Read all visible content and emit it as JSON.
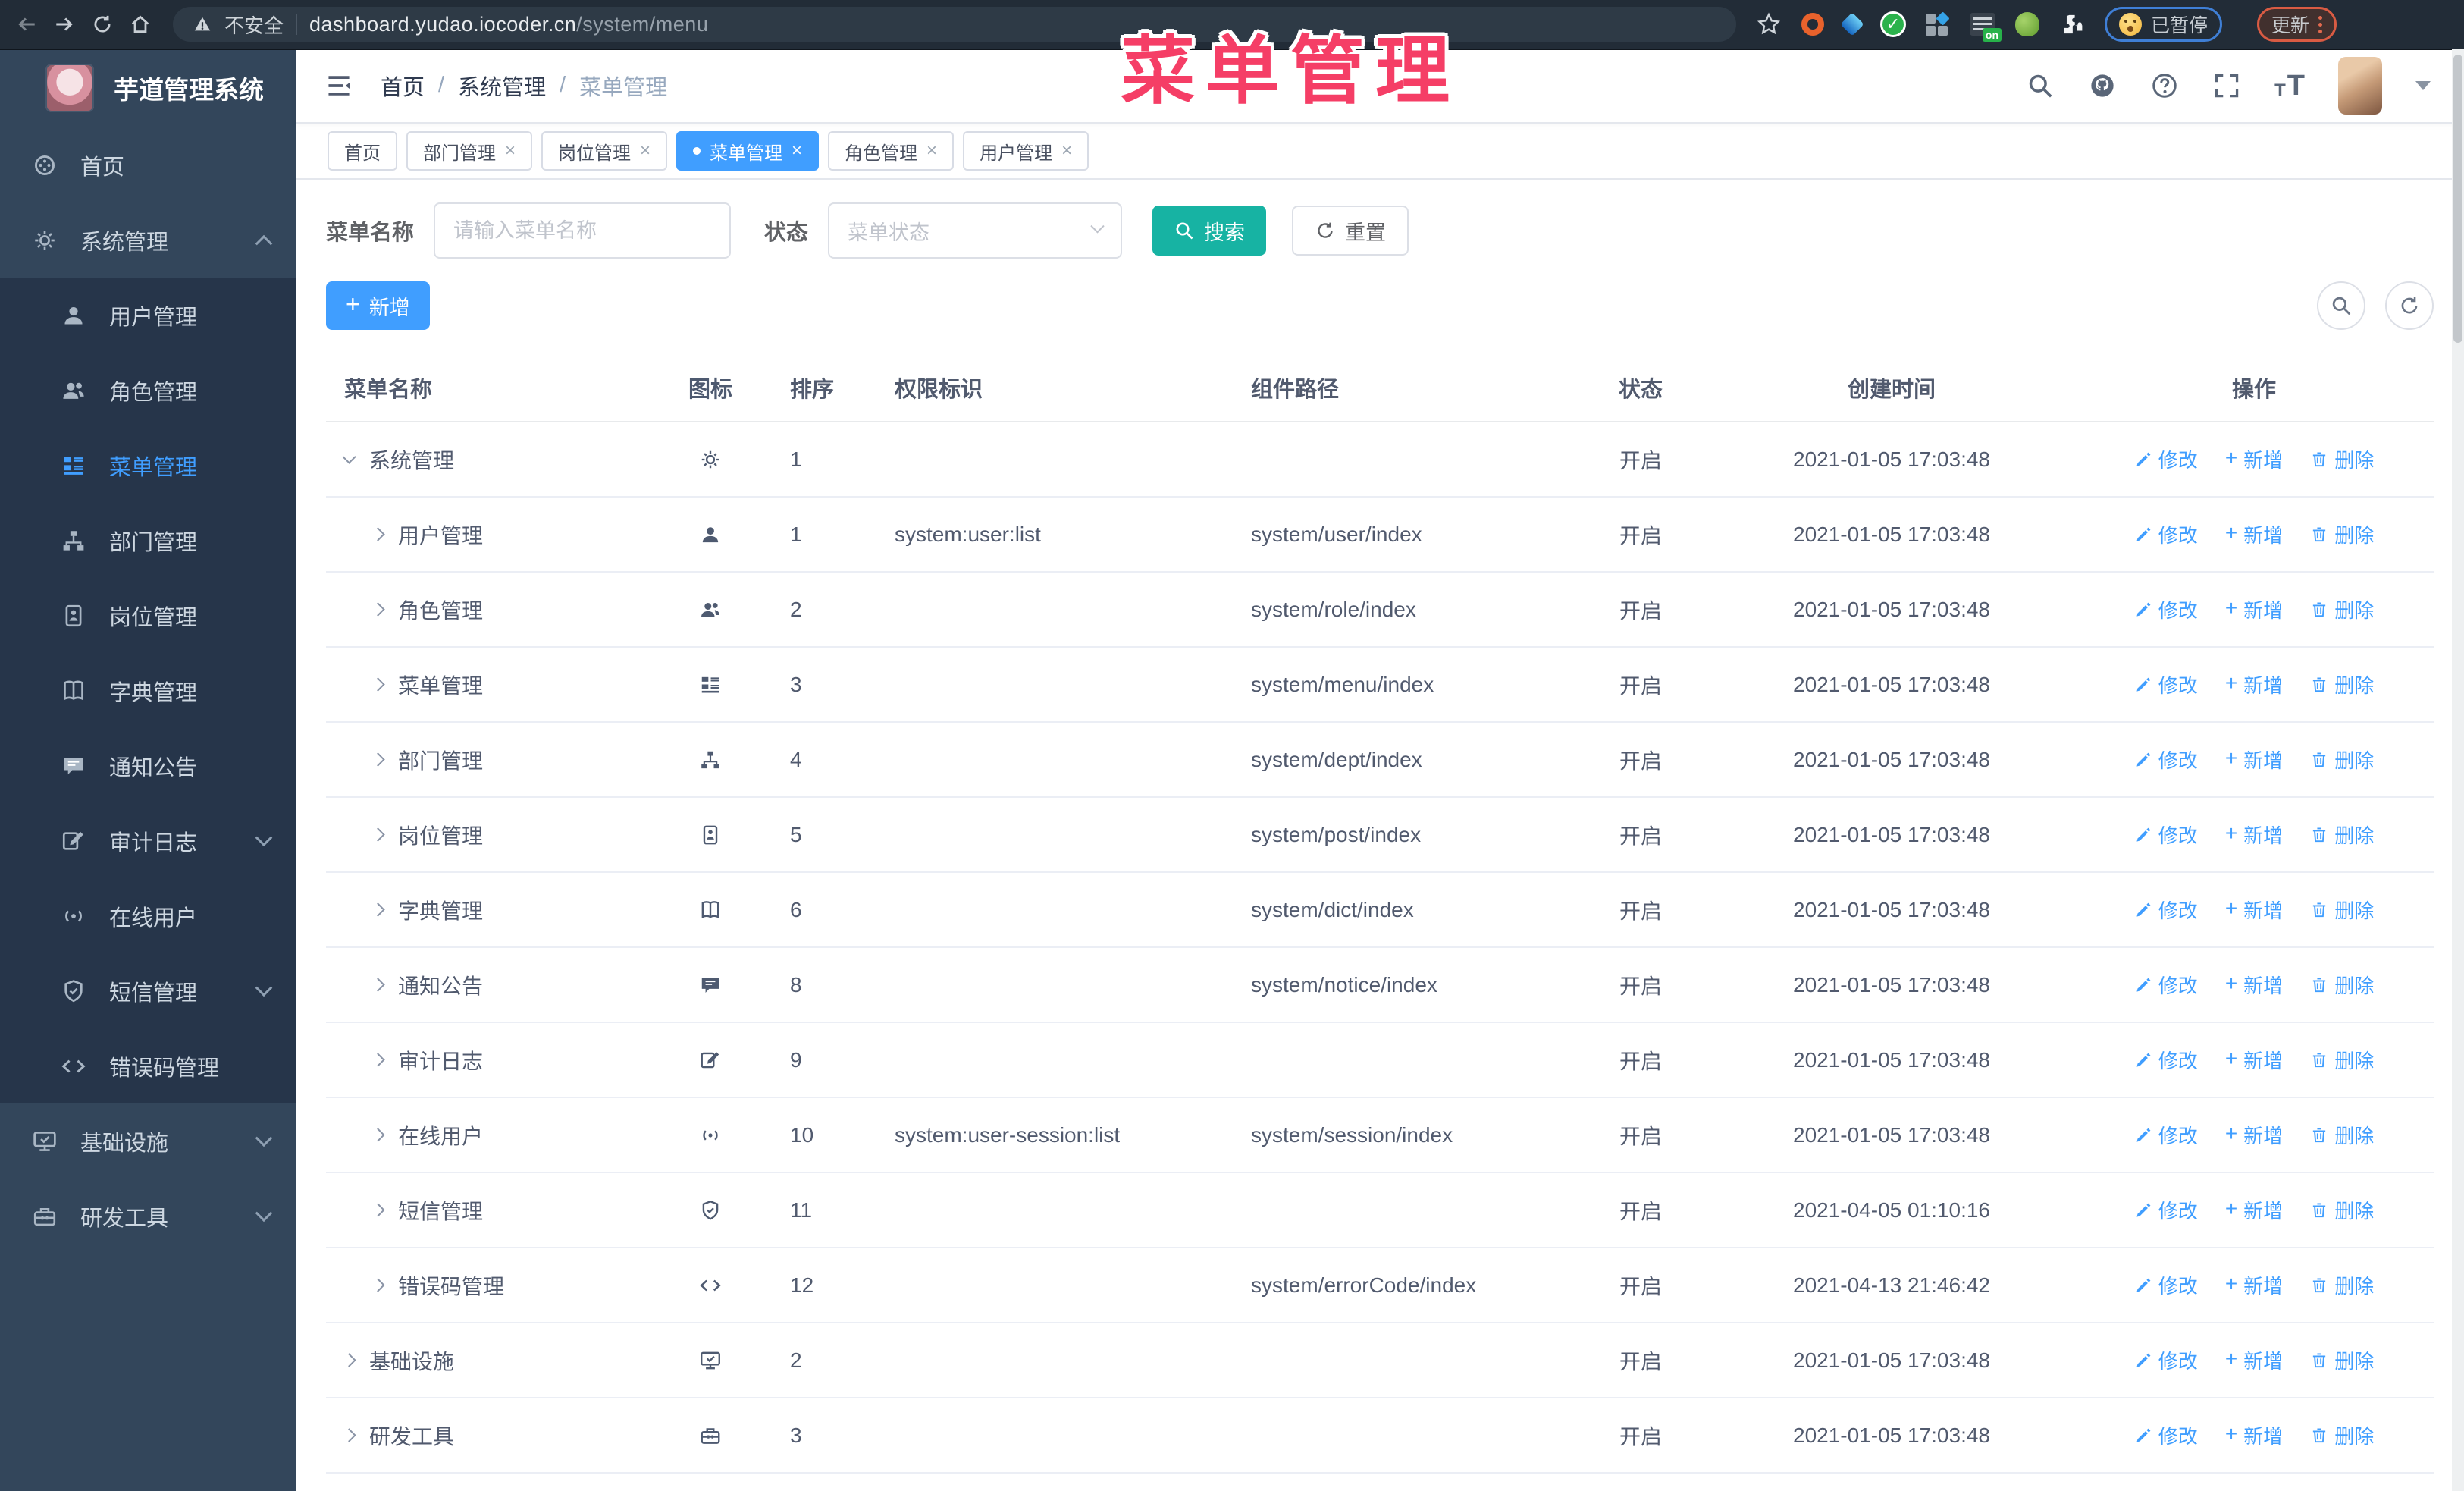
{
  "browser": {
    "security_label": "不安全",
    "url_host": "dashboard.yudao.iocoder.cn",
    "url_path": "/system/menu",
    "paused_label": "已暂停",
    "update_label": "更新"
  },
  "annotation": {
    "text": "菜单管理",
    "color": "#f53e66"
  },
  "sidebar": {
    "title": "芋道管理系统",
    "items": [
      {
        "id": "home",
        "label": "首页",
        "icon": "home"
      },
      {
        "id": "system",
        "label": "系统管理",
        "icon": "gear",
        "chevron": "up"
      },
      {
        "id": "user",
        "label": "用户管理",
        "icon": "user",
        "child": true
      },
      {
        "id": "role",
        "label": "角色管理",
        "icon": "users",
        "child": true
      },
      {
        "id": "menu",
        "label": "菜单管理",
        "icon": "menu",
        "child": true,
        "active": true
      },
      {
        "id": "dept",
        "label": "部门管理",
        "icon": "tree",
        "child": true
      },
      {
        "id": "post",
        "label": "岗位管理",
        "icon": "post",
        "child": true
      },
      {
        "id": "dict",
        "label": "字典管理",
        "icon": "dict",
        "child": true
      },
      {
        "id": "notice",
        "label": "通知公告",
        "icon": "notice",
        "child": true
      },
      {
        "id": "audit",
        "label": "审计日志",
        "icon": "edit",
        "child": true,
        "chevron": "down"
      },
      {
        "id": "online",
        "label": "在线用户",
        "icon": "online",
        "child": true
      },
      {
        "id": "sms",
        "label": "短信管理",
        "icon": "sms",
        "child": true,
        "chevron": "down"
      },
      {
        "id": "errcode",
        "label": "错误码管理",
        "icon": "code",
        "child": true
      },
      {
        "id": "infra",
        "label": "基础设施",
        "icon": "monitor",
        "chevron": "down"
      },
      {
        "id": "devtool",
        "label": "研发工具",
        "icon": "tool",
        "chevron": "down"
      }
    ]
  },
  "header": {
    "breadcrumb": [
      "首页",
      "系统管理",
      "菜单管理"
    ]
  },
  "tabs": [
    {
      "label": "首页",
      "closable": false,
      "active": false
    },
    {
      "label": "部门管理",
      "closable": true,
      "active": false
    },
    {
      "label": "岗位管理",
      "closable": true,
      "active": false
    },
    {
      "label": "菜单管理",
      "closable": true,
      "active": true
    },
    {
      "label": "角色管理",
      "closable": true,
      "active": false
    },
    {
      "label": "用户管理",
      "closable": true,
      "active": false
    }
  ],
  "filters": {
    "name_label": "菜单名称",
    "name_placeholder": "请输入菜单名称",
    "status_label": "状态",
    "status_placeholder": "菜单状态",
    "search_label": "搜索",
    "reset_label": "重置"
  },
  "toolbar": {
    "add_label": "新增"
  },
  "colors": {
    "primary": "#409eff",
    "search_button": "#17b3a3",
    "annotation_pink": "#f53e66",
    "sidebar_bg": "#33465b",
    "submenu_bg": "#26354a"
  },
  "table": {
    "columns": [
      "菜单名称",
      "图标",
      "排序",
      "权限标识",
      "组件路径",
      "状态",
      "创建时间",
      "操作"
    ],
    "actions": {
      "edit": "修改",
      "add": "新增",
      "delete": "删除"
    },
    "rows": [
      {
        "name": "系统管理",
        "icon": "gear",
        "level": 0,
        "expanded": true,
        "sort": "1",
        "perm": "",
        "path": "",
        "status": "开启",
        "created": "2021-01-05 17:03:48"
      },
      {
        "name": "用户管理",
        "icon": "user",
        "level": 1,
        "expanded": false,
        "sort": "1",
        "perm": "system:user:list",
        "path": "system/user/index",
        "status": "开启",
        "created": "2021-01-05 17:03:48"
      },
      {
        "name": "角色管理",
        "icon": "users",
        "level": 1,
        "expanded": false,
        "sort": "2",
        "perm": "",
        "path": "system/role/index",
        "status": "开启",
        "created": "2021-01-05 17:03:48"
      },
      {
        "name": "菜单管理",
        "icon": "menu",
        "level": 1,
        "expanded": false,
        "sort": "3",
        "perm": "",
        "path": "system/menu/index",
        "status": "开启",
        "created": "2021-01-05 17:03:48"
      },
      {
        "name": "部门管理",
        "icon": "tree",
        "level": 1,
        "expanded": false,
        "sort": "4",
        "perm": "",
        "path": "system/dept/index",
        "status": "开启",
        "created": "2021-01-05 17:03:48"
      },
      {
        "name": "岗位管理",
        "icon": "post",
        "level": 1,
        "expanded": false,
        "sort": "5",
        "perm": "",
        "path": "system/post/index",
        "status": "开启",
        "created": "2021-01-05 17:03:48"
      },
      {
        "name": "字典管理",
        "icon": "dict",
        "level": 1,
        "expanded": false,
        "sort": "6",
        "perm": "",
        "path": "system/dict/index",
        "status": "开启",
        "created": "2021-01-05 17:03:48"
      },
      {
        "name": "通知公告",
        "icon": "notice",
        "level": 1,
        "expanded": false,
        "sort": "8",
        "perm": "",
        "path": "system/notice/index",
        "status": "开启",
        "created": "2021-01-05 17:03:48"
      },
      {
        "name": "审计日志",
        "icon": "edit",
        "level": 1,
        "expanded": false,
        "sort": "9",
        "perm": "",
        "path": "",
        "status": "开启",
        "created": "2021-01-05 17:03:48"
      },
      {
        "name": "在线用户",
        "icon": "online",
        "level": 1,
        "expanded": false,
        "sort": "10",
        "perm": "system:user-session:list",
        "path": "system/session/index",
        "status": "开启",
        "created": "2021-01-05 17:03:48"
      },
      {
        "name": "短信管理",
        "icon": "sms",
        "level": 1,
        "expanded": false,
        "sort": "11",
        "perm": "",
        "path": "",
        "status": "开启",
        "created": "2021-04-05 01:10:16"
      },
      {
        "name": "错误码管理",
        "icon": "code",
        "level": 1,
        "expanded": false,
        "sort": "12",
        "perm": "",
        "path": "system/errorCode/index",
        "status": "开启",
        "created": "2021-04-13 21:46:42"
      },
      {
        "name": "基础设施",
        "icon": "monitor",
        "level": 0,
        "expanded": false,
        "sort": "2",
        "perm": "",
        "path": "",
        "status": "开启",
        "created": "2021-01-05 17:03:48"
      },
      {
        "name": "研发工具",
        "icon": "tool",
        "level": 0,
        "expanded": false,
        "sort": "3",
        "perm": "",
        "path": "",
        "status": "开启",
        "created": "2021-01-05 17:03:48"
      }
    ]
  }
}
